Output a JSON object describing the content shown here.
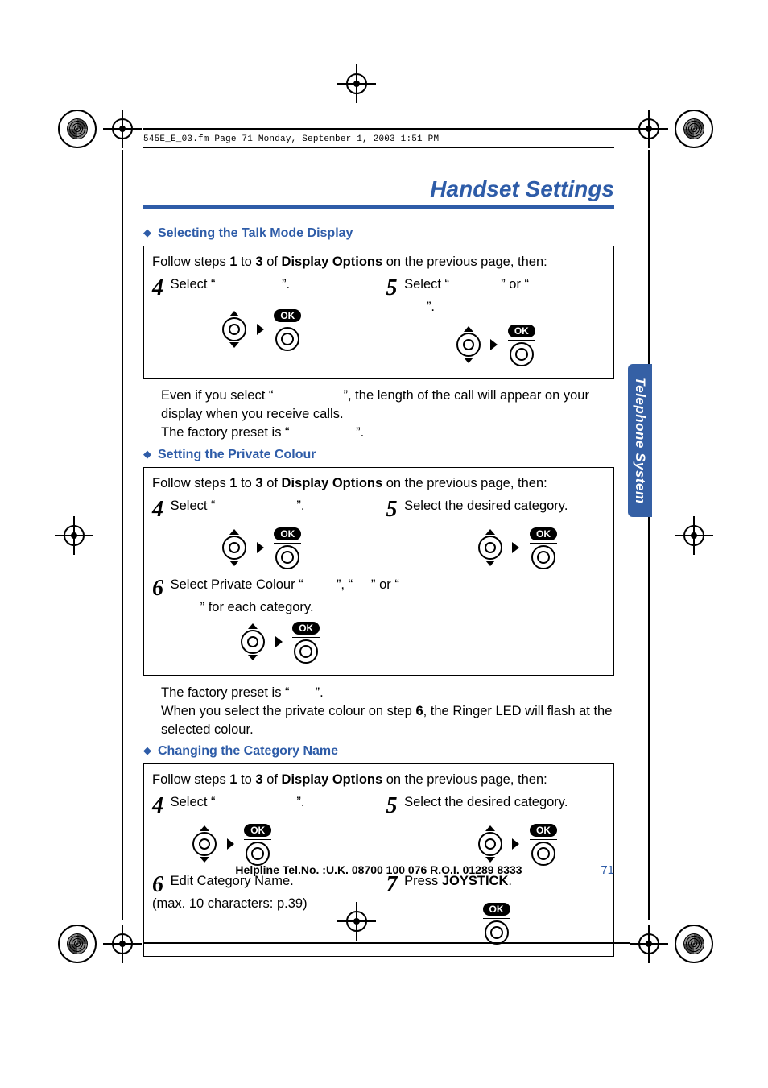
{
  "meta_header": "545E_E_03.fm  Page 71  Monday, September 1, 2003  1:51 PM",
  "page_title": "Handset Settings",
  "side_tab": "Telephone System",
  "sections": {
    "talk_mode": {
      "heading": "Selecting the Talk Mode Display",
      "intro_pre": "Follow steps ",
      "intro_b1": "1",
      "intro_mid1": " to ",
      "intro_b2": "3",
      "intro_mid2": " of ",
      "intro_b3": "Display Options",
      "intro_post": " on the previous page, then:",
      "step4_num": "4",
      "step4_pre": "Select “",
      "step4_post": "”.",
      "step5_num": "5",
      "step5_pre": "Select “",
      "step5_mid": "” or “",
      "step5_post": "”.",
      "note1": "Even if you select “",
      "note1b": "”, the length of the call will appear on your display when you receive calls.",
      "note2": "The factory preset is “",
      "note2b": "”."
    },
    "private_colour": {
      "heading": "Setting the Private Colour",
      "intro_pre": "Follow steps ",
      "intro_b1": "1",
      "intro_mid1": " to ",
      "intro_b2": "3",
      "intro_mid2": " of ",
      "intro_b3": "Display Options",
      "intro_post": " on the previous page, then:",
      "step4_num": "4",
      "step4_pre": "Select “",
      "step4_post": "”.",
      "step5_num": "5",
      "step5_text": "Select the desired category.",
      "step6_num": "6",
      "step6_a": "Select Private Colour “",
      "step6_b": "”, “",
      "step6_c": "” or “",
      "step6_d": "” for each category.",
      "note_a": "The factory preset is “",
      "note_b": "”.",
      "note_c_pre": "When you select the private colour on step ",
      "note_c_bold": "6",
      "note_c_post": ", the Ringer LED will flash at the selected colour."
    },
    "category_name": {
      "heading": "Changing the Category Name",
      "intro_pre": "Follow steps ",
      "intro_b1": "1",
      "intro_mid1": " to ",
      "intro_b2": "3",
      "intro_mid2": " of ",
      "intro_b3": "Display Options",
      "intro_post": " on the previous page, then:",
      "step4_num": "4",
      "step4_pre": "Select “",
      "step4_post": "”.",
      "step5_num": "5",
      "step5_text": "Select the desired category.",
      "step6_num": "6",
      "step6_l1": "Edit Category Name.",
      "step6_l2": "(max. 10 characters: p.39)",
      "step7_num": "7",
      "step7_pre": "Press ",
      "step7_bold": "JOYSTICK",
      "step7_post": "."
    }
  },
  "ok_label": "OK",
  "footer_help": "Helpline Tel.No. :U.K. 08700 100 076  R.O.I. 01289 8333",
  "page_number": "71"
}
